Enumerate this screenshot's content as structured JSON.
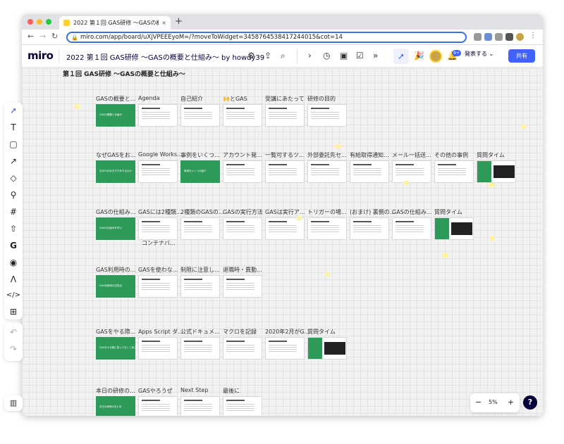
{
  "browser": {
    "tab_title": "2022 第１回 GAS研修 〜GASの概",
    "new_tab": "+",
    "url": "miro.com/app/board/uXjVPEEEyoM=/?moveToWidget=3458764538417244015&cot=14",
    "nav": {
      "back": "←",
      "forward": "→",
      "reload": "↻"
    }
  },
  "miro": {
    "logo": "miro",
    "board_name": "2022 第１回 GAS研修 〜GASの概要と仕組み〜 by howdy39",
    "present_label": "発表する",
    "share_label": "共有",
    "notification_count": "9+",
    "frame_title": "第１回 GAS研修 〜GASの概要と仕組み〜",
    "zoom": "5%",
    "zoom_out": "−",
    "zoom_in": "+",
    "help": "?"
  },
  "rows": [
    [
      "GASの概要と...",
      "Agenda",
      "自己紹介",
      "🙌とGAS",
      "受講にあたって",
      "研修の目的"
    ],
    [
      "なぜGASをお...",
      "Google Works...",
      "事例をいくつ...",
      "アカウント発...",
      "一覧可するツ...",
      "外部委託先セ...",
      "有給取得通知...",
      "メール一括送...",
      "その他の事例",
      "質問タイム"
    ],
    [
      "GASの仕組み...",
      "GASには2種類...",
      "2種類のGASの...",
      "GASの実行方法",
      "GASは実行ア...",
      "トリガーの場...",
      "(おまけ) 裏側の...",
      "GASの仕組み...",
      "質問タイム"
    ],
    [
      "GAS利用時の...",
      "GASを使わな...",
      "制限に注意し...",
      "退職時・異動..."
    ],
    [
      "GASをやる際...",
      "Apps Script ダ...",
      "公式ドキュメ...",
      "マクロを記録",
      "2020年2月がG...",
      "質問タイム"
    ],
    [
      "本日の研修の...",
      "GASやろうぜ",
      "Next Step",
      "最後に"
    ]
  ],
  "extra_label": "コンテナバ...",
  "slide_texts": [
    "GASの概要と仕組み",
    "なぜGASをおすすめするのか",
    "事例をいくつか紹介",
    "GASの仕組みを学ぶ",
    "GAS利用時の注意点",
    "GASをやる際に知っておくと良さそうなこと",
    "本日の研修のまとめ"
  ],
  "qa_side_text": "質問タイム"
}
